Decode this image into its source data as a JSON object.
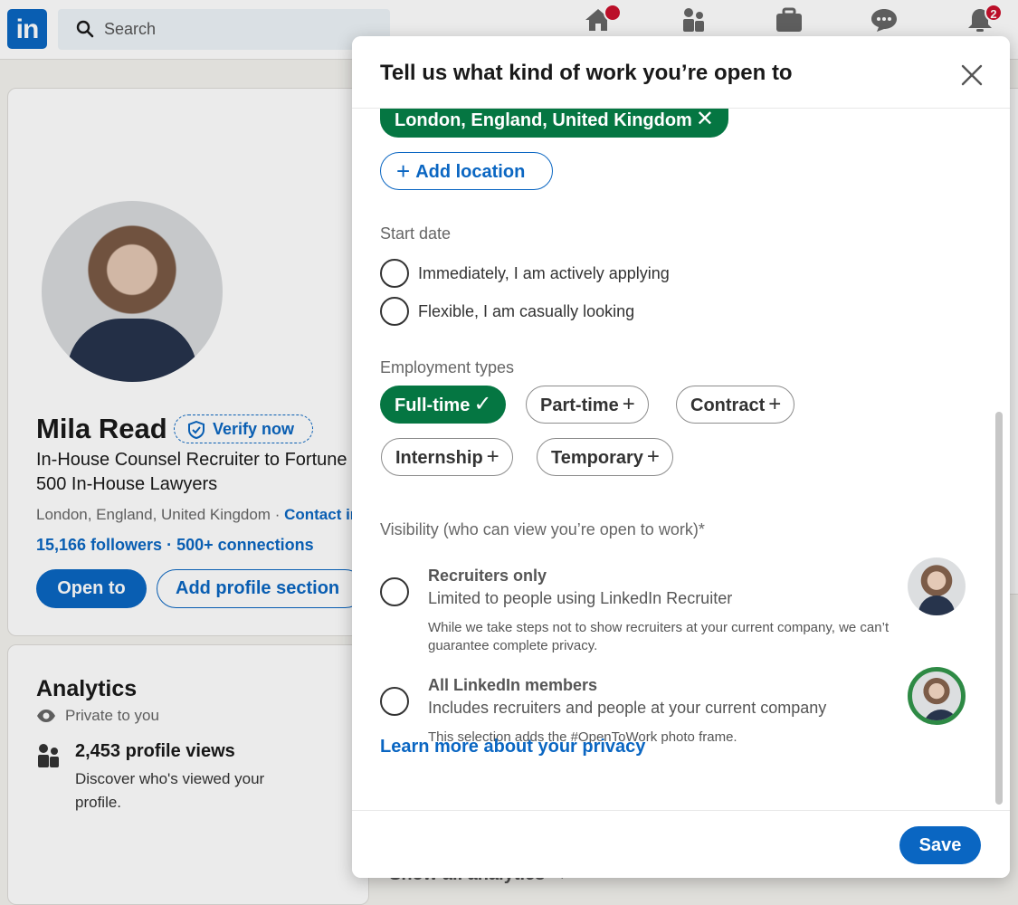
{
  "nav": {
    "logo": "in",
    "search_placeholder": "Search",
    "messaging_badge": "",
    "notifications_badge": "2"
  },
  "profile": {
    "name": "Mila Read",
    "verify_label": "Verify now",
    "headline": "In-House Counsel Recruiter to Fortune 500 In-House Lawyers",
    "location": "London, England, United Kingdom · ",
    "contact_link": "Contact info",
    "followers": "15,166 followers",
    "connections": "· 500+ connections",
    "open_to_label": "Open to",
    "add_section_label": "Add profile section"
  },
  "analytics": {
    "title": "Analytics",
    "privacy": "Private to you",
    "views_title": "2,453 profile views",
    "views_sub": "Discover who's viewed your profile.",
    "show_all": "Show all analytics →"
  },
  "modal": {
    "title": "Tell us what kind of work you’re open to",
    "location_chip": "London, England, United Kingdom",
    "add_location_label": "Add location",
    "start_date_label": "Start date",
    "start_date_options": [
      "Immediately, I am actively applying",
      "Flexible, I am casually looking"
    ],
    "employment_label": "Employment types",
    "employment_types": [
      {
        "label": "Full-time",
        "selected": true
      },
      {
        "label": "Part-time",
        "selected": false
      },
      {
        "label": "Contract",
        "selected": false
      },
      {
        "label": "Internship",
        "selected": false
      },
      {
        "label": "Temporary",
        "selected": false
      }
    ],
    "visibility_label": "Visibility (who can view you’re open to work)*",
    "visibility_options": [
      {
        "title": "Recruiters only",
        "subtitle": "Limited to people using LinkedIn Recruiter",
        "note": "While we take steps not to show recruiters at your current company, we can’t guarantee complete privacy."
      },
      {
        "title": "All LinkedIn members",
        "subtitle": "Includes recruiters and people at your current company",
        "note": "This selection adds the #OpenToWork photo frame."
      }
    ],
    "learn_more": "Learn more about your privacy",
    "save_label": "Save"
  },
  "colors": {
    "brand_blue": "#0a66c2",
    "selected_green": "#057642",
    "notification_red": "#cb112d"
  }
}
